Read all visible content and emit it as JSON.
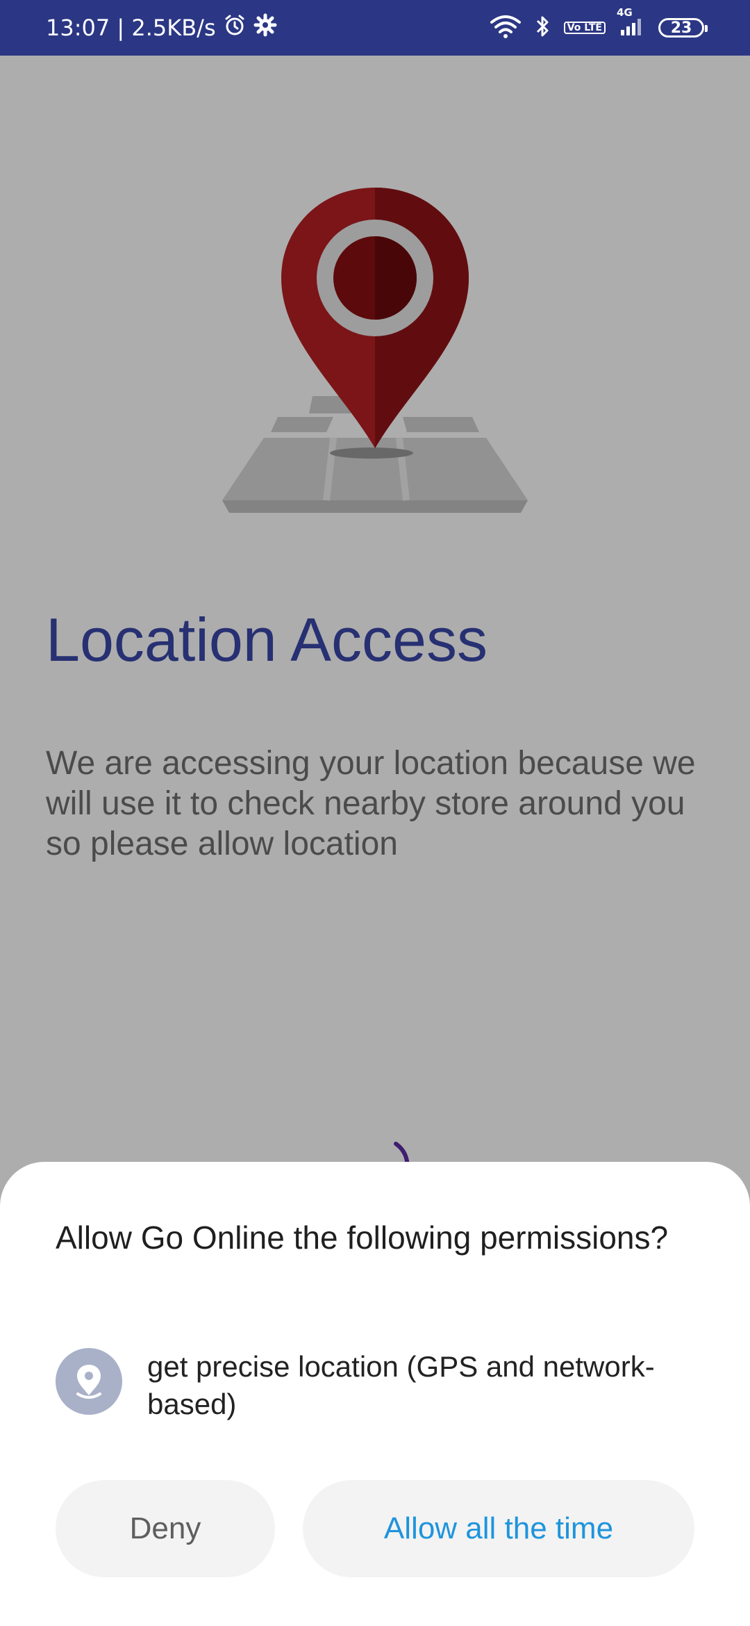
{
  "status_bar": {
    "time_speed": "13:07 | 2.5KB/s",
    "network_type": "4G",
    "volte": "Vo LTE",
    "battery": "23"
  },
  "page": {
    "title": "Location Access",
    "description": "We are accessing your location because we will use it to check nearby store around you so please allow location"
  },
  "dialog": {
    "title": "Allow Go Online the following permissions?",
    "permission": "get precise location (GPS and network-based)",
    "deny_label": "Deny",
    "allow_label": "Allow all the time"
  },
  "colors": {
    "status_bar": "#2b3784",
    "title": "#3a48a8",
    "allow_text": "#1e94dc",
    "pin": "#b51f24"
  }
}
